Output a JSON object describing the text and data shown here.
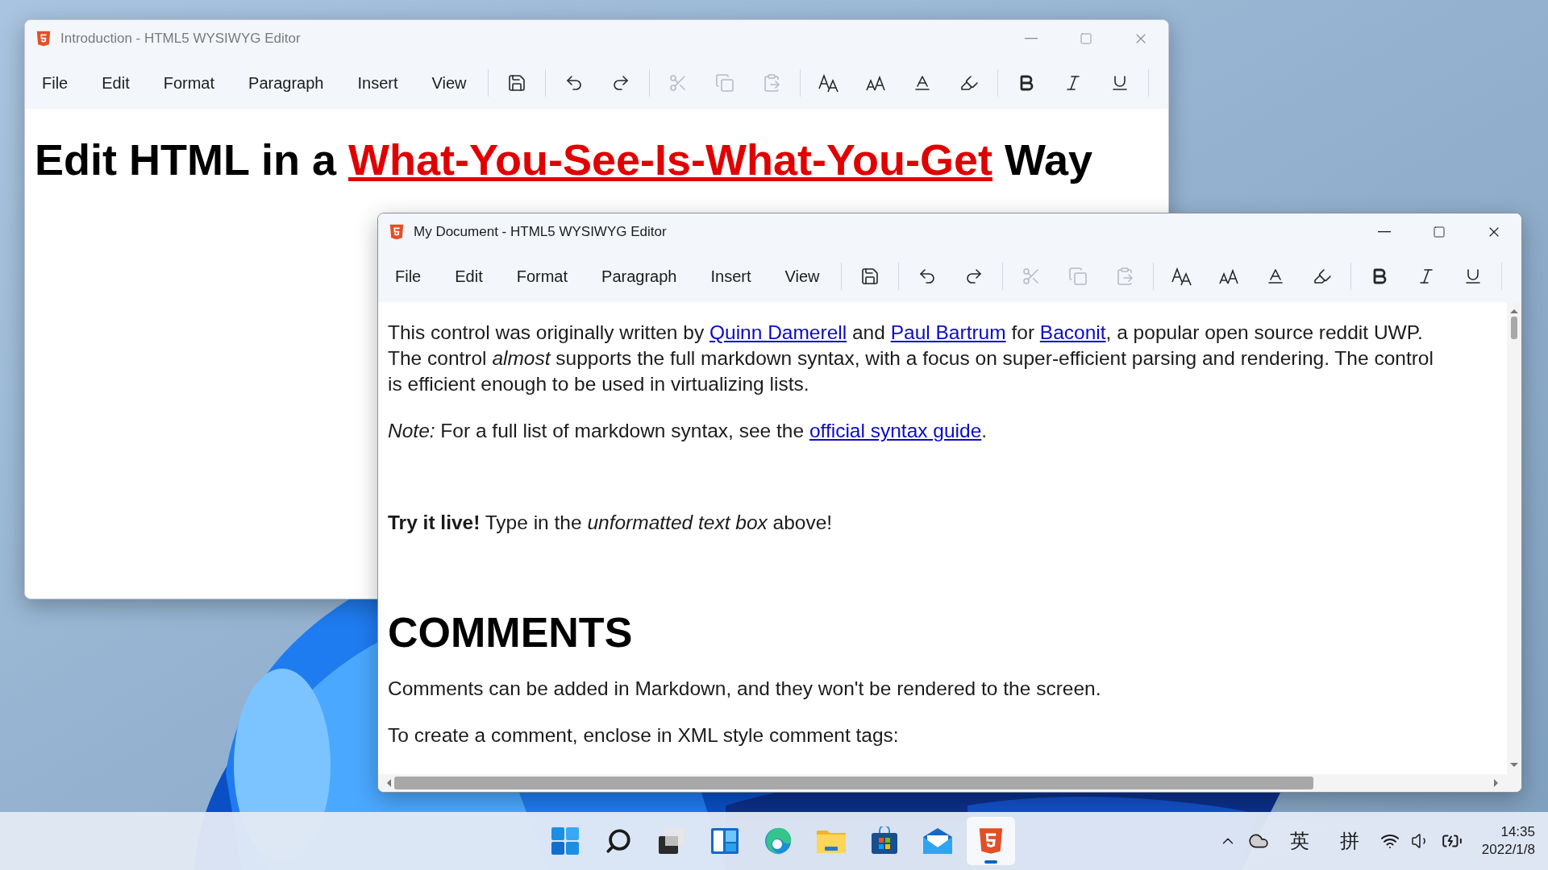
{
  "windows": [
    {
      "title": "Introduction - HTML5 WYSIWYG Editor",
      "active": false,
      "menus": [
        "File",
        "Edit",
        "Format",
        "Paragraph",
        "Insert",
        "View"
      ],
      "tools": [
        {
          "kind": "save",
          "disabled": false,
          "separator_before": true
        },
        {
          "kind": "undo",
          "disabled": false,
          "separator_before": true
        },
        {
          "kind": "redo",
          "disabled": false,
          "separator_before": false
        },
        {
          "kind": "cut",
          "disabled": true,
          "separator_before": true
        },
        {
          "kind": "copy",
          "disabled": true,
          "separator_before": false
        },
        {
          "kind": "paste",
          "disabled": true,
          "separator_before": false
        },
        {
          "kind": "grow",
          "disabled": false,
          "separator_before": true
        },
        {
          "kind": "shrink",
          "disabled": false,
          "separator_before": false
        },
        {
          "kind": "fontcolor",
          "disabled": false,
          "separator_before": false
        },
        {
          "kind": "highlight",
          "disabled": false,
          "separator_before": false
        },
        {
          "kind": "bold",
          "disabled": false,
          "separator_before": true
        },
        {
          "kind": "italic",
          "disabled": false,
          "separator_before": false
        },
        {
          "kind": "underline",
          "disabled": false,
          "separator_before": false
        }
      ],
      "content": [
        {
          "kind": "title",
          "segments": [
            {
              "kind": "plain",
              "text": "Edit HTML in a "
            },
            {
              "kind": "accent",
              "text": "What-You-See-Is-What-You-Get"
            },
            {
              "kind": "plain",
              "text": " Way"
            }
          ]
        }
      ]
    },
    {
      "title": "My Document - HTML5 WYSIWYG Editor",
      "active": true,
      "menus": [
        "File",
        "Edit",
        "Format",
        "Paragraph",
        "Insert",
        "View"
      ],
      "tools": [
        {
          "kind": "save",
          "disabled": false,
          "separator_before": true
        },
        {
          "kind": "undo",
          "disabled": false,
          "separator_before": true
        },
        {
          "kind": "redo",
          "disabled": false,
          "separator_before": false
        },
        {
          "kind": "cut",
          "disabled": true,
          "separator_before": true
        },
        {
          "kind": "copy",
          "disabled": true,
          "separator_before": false
        },
        {
          "kind": "paste",
          "disabled": true,
          "separator_before": false
        },
        {
          "kind": "grow",
          "disabled": false,
          "separator_before": true
        },
        {
          "kind": "shrink",
          "disabled": false,
          "separator_before": false
        },
        {
          "kind": "fontcolor",
          "disabled": false,
          "separator_before": false
        },
        {
          "kind": "highlight",
          "disabled": false,
          "separator_before": false
        },
        {
          "kind": "bold",
          "disabled": false,
          "separator_before": true
        },
        {
          "kind": "italic",
          "disabled": false,
          "separator_before": false
        },
        {
          "kind": "underline",
          "disabled": false,
          "separator_before": false
        }
      ],
      "content": [
        {
          "kind": "paragraph",
          "segments": [
            {
              "kind": "plain",
              "text": "This control was originally written by "
            },
            {
              "kind": "link",
              "text": "Quinn Damerell"
            },
            {
              "kind": "plain",
              "text": " and "
            },
            {
              "kind": "link",
              "text": "Paul Bartrum"
            },
            {
              "kind": "plain",
              "text": " for "
            },
            {
              "kind": "link",
              "text": "Baconit"
            },
            {
              "kind": "plain",
              "text": ", a popular open source reddit UWP. The control "
            },
            {
              "kind": "italic",
              "text": "almost"
            },
            {
              "kind": "plain",
              "text": " supports the full markdown syntax, with a focus on super-efficient parsing and rendering. The control is efficient enough to be used in virtualizing lists."
            }
          ]
        },
        {
          "kind": "paragraph",
          "segments": [
            {
              "kind": "italic",
              "text": "Note:"
            },
            {
              "kind": "plain",
              "text": " For a full list of markdown syntax, see the "
            },
            {
              "kind": "link",
              "text": "official syntax guide"
            },
            {
              "kind": "plain",
              "text": "."
            }
          ]
        },
        {
          "kind": "callout",
          "segments": [
            {
              "kind": "bold",
              "text": "Try it live!"
            },
            {
              "kind": "plain",
              "text": " Type in the "
            },
            {
              "kind": "italic",
              "text": "unformatted text box"
            },
            {
              "kind": "plain",
              "text": " above!"
            }
          ]
        },
        {
          "kind": "heading",
          "segments": [
            {
              "kind": "plain",
              "text": "COMMENTS"
            }
          ]
        },
        {
          "kind": "paragraph",
          "segments": [
            {
              "kind": "plain",
              "text": "Comments can be added in Markdown, and they won't be rendered to the screen."
            }
          ]
        },
        {
          "kind": "paragraph",
          "segments": [
            {
              "kind": "plain",
              "text": "To create a comment, enclose in XML style comment tags:"
            }
          ]
        }
      ]
    }
  ],
  "taskbar": {
    "apps": [
      {
        "kind": "start",
        "selected": false
      },
      {
        "kind": "search",
        "selected": false
      },
      {
        "kind": "taskview",
        "selected": false
      },
      {
        "kind": "widgets",
        "selected": false
      },
      {
        "kind": "browser",
        "selected": false
      },
      {
        "kind": "files",
        "selected": false
      },
      {
        "kind": "store",
        "selected": false
      },
      {
        "kind": "mail",
        "selected": false
      },
      {
        "kind": "editor",
        "selected": true
      }
    ],
    "tray": {
      "input_language": "英",
      "input_mode": "拼",
      "time": "14:35",
      "date": "2022/1/8"
    }
  }
}
